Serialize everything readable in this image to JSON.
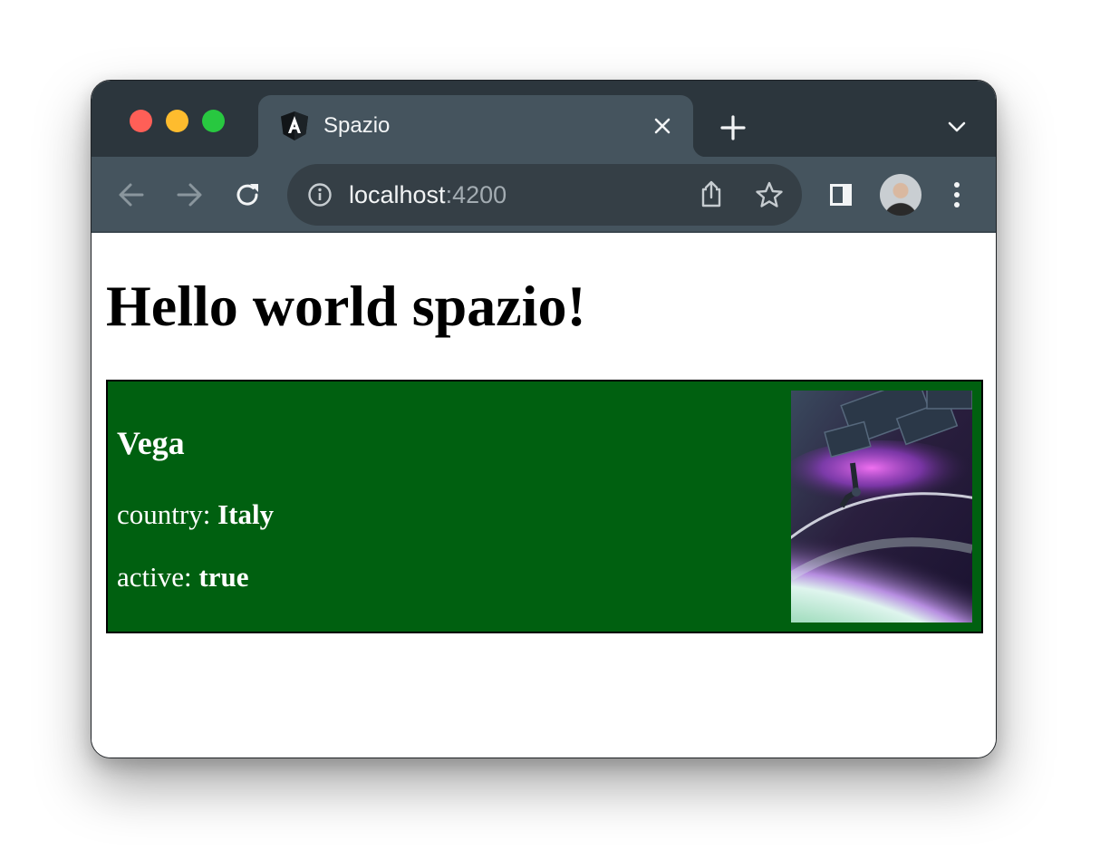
{
  "browser": {
    "tab": {
      "title": "Spazio",
      "favicon": "angular-logo-icon"
    },
    "address": {
      "host": "localhost",
      "port": ":4200"
    },
    "icons": {
      "back": "arrow-left-icon",
      "forward": "arrow-right-icon",
      "reload": "reload-icon",
      "info": "info-icon",
      "share": "share-icon",
      "bookmark": "star-icon",
      "sidepanel": "side-panel-icon",
      "menu": "kebab-menu-icon"
    },
    "colors": {
      "tabbar": "#2c363d",
      "toolbar": "#45545e",
      "omnibox": "#353f46"
    }
  },
  "page": {
    "heading": "Hello world spazio!",
    "card": {
      "name": "Vega",
      "country_label": "country:",
      "country_value": "Italy",
      "active_label": "active:",
      "active_value": "true",
      "background": "#006010",
      "image": "space-station-earth-photo"
    }
  }
}
